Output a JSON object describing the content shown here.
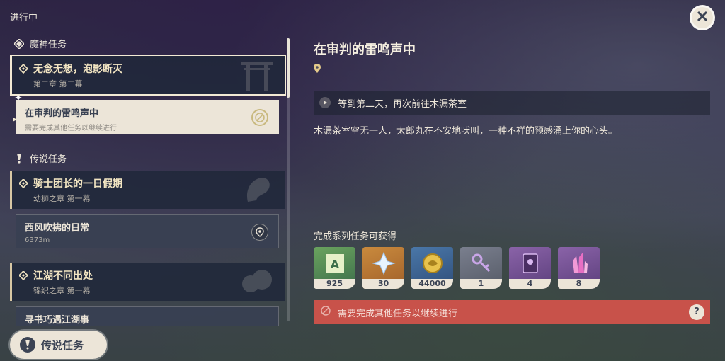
{
  "header": {
    "status_title": "进行中"
  },
  "categories": {
    "archon": {
      "label": "魔神任务"
    },
    "legend": {
      "label": "传说任务"
    }
  },
  "quests": [
    {
      "title": "无念无想，泡影断灭",
      "chapter": "第二章 第二幕",
      "sub": {
        "title": "在审判的雷鸣声中",
        "meta": "需要完成其他任务以继续进行"
      }
    },
    {
      "title": "骑士团长的一日假期",
      "chapter": "幼狮之章 第一幕",
      "sub": {
        "title": "西风吹拂的日常",
        "meta": "6373m"
      }
    },
    {
      "title": "江湖不同出处",
      "chapter": "锦织之章 第一幕",
      "sub": {
        "title": "寻书巧遇江湖事",
        "meta": ""
      }
    }
  ],
  "bottom_button": {
    "label": "传说任务"
  },
  "detail": {
    "title": "在审判的雷鸣声中",
    "objective": "等到第二天，再次前往木漏茶室",
    "description": "木漏茶室空无一人，太郎丸在不安地吠叫，一种不祥的预感涌上你的心头。",
    "rewards_heading": "完成系列任务可获得",
    "rewards": [
      {
        "icon": "adventure-exp-icon",
        "value": "925"
      },
      {
        "icon": "primogem-icon",
        "value": "30"
      },
      {
        "icon": "mora-icon",
        "value": "44000"
      },
      {
        "icon": "key-item-icon",
        "value": "1"
      },
      {
        "icon": "talent-book-icon",
        "value": "4"
      },
      {
        "icon": "crystal-icon",
        "value": "8"
      }
    ],
    "warning": "需要完成其他任务以继续进行",
    "help_label": "?"
  },
  "colors": {
    "cream": "#ece5d8",
    "warning_red": "#c8524a",
    "gold": "#f2e5c2"
  }
}
